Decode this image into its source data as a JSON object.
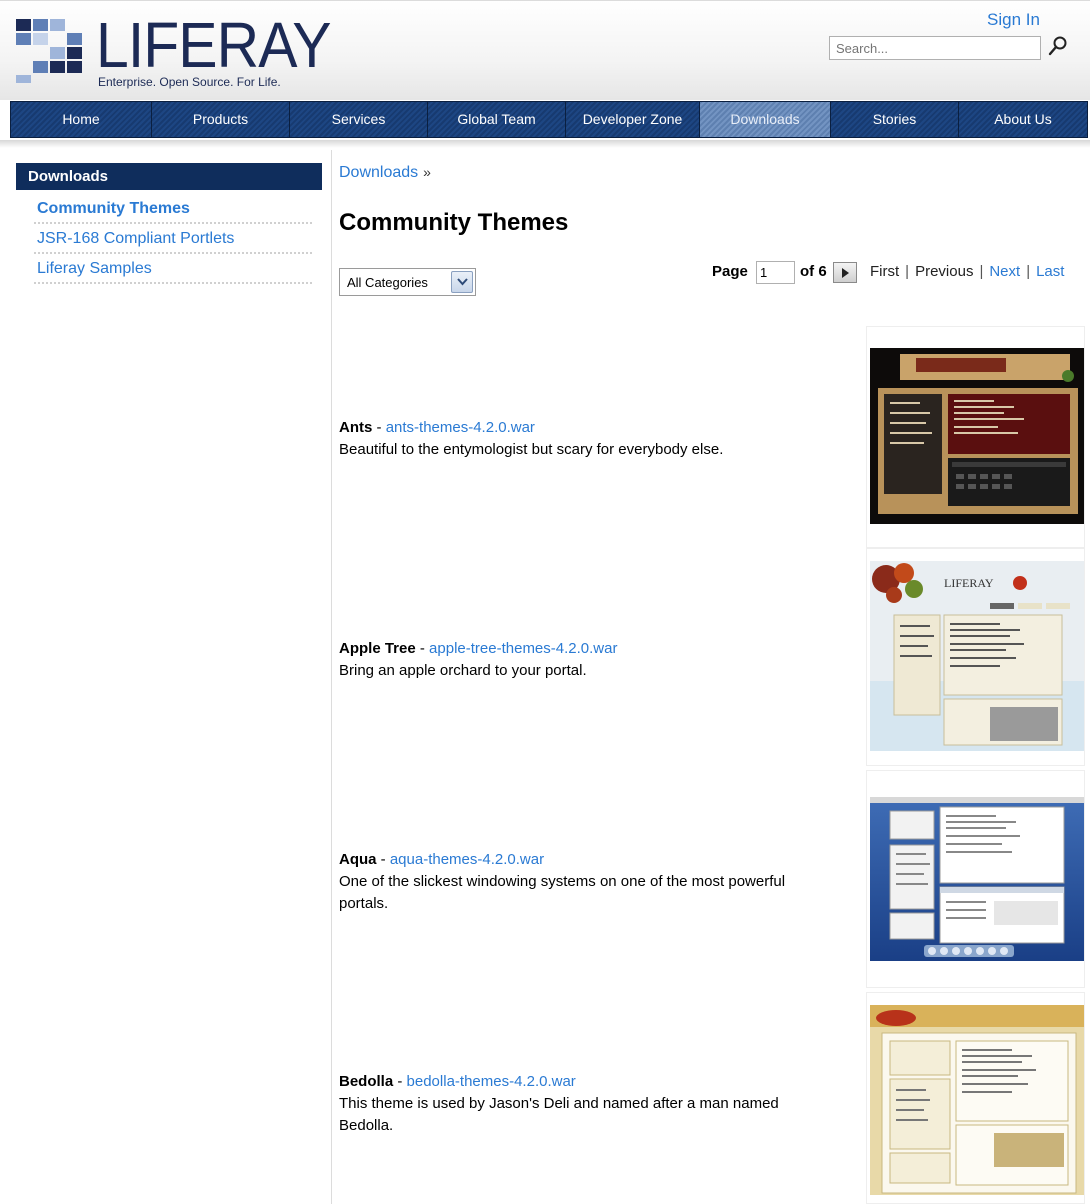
{
  "header": {
    "logo_text": "LIFERAY",
    "logo_tagline": "Enterprise. Open Source. For Life.",
    "sign_in": "Sign In",
    "search_placeholder": "Search..."
  },
  "nav": {
    "items": [
      {
        "label": "Home"
      },
      {
        "label": "Products"
      },
      {
        "label": "Services"
      },
      {
        "label": "Global Team"
      },
      {
        "label": "Developer Zone"
      },
      {
        "label": "Downloads"
      },
      {
        "label": "Stories"
      },
      {
        "label": "About Us"
      }
    ],
    "active": "Downloads"
  },
  "sidebar": {
    "title": "Downloads",
    "items": [
      {
        "label": "Community Themes"
      },
      {
        "label": "JSR-168 Compliant Portlets"
      },
      {
        "label": "Liferay Samples"
      }
    ]
  },
  "main": {
    "breadcrumb": "Downloads",
    "breadcrumb_sep": "»",
    "title": "Community Themes",
    "category_select": "All Categories",
    "pager": {
      "page_label": "Page",
      "page_value": "1",
      "of_label": "of 6",
      "first": "First",
      "previous": "Previous",
      "next": "Next",
      "last": "Last"
    },
    "themes": [
      {
        "name": "Ants",
        "file": "ants-themes-4.2.0.war",
        "description": "Beautiful to the entymologist but scary for everybody else."
      },
      {
        "name": "Apple Tree",
        "file": "apple-tree-themes-4.2.0.war",
        "description": "Bring an apple orchard to your portal."
      },
      {
        "name": "Aqua",
        "file": "aqua-themes-4.2.0.war",
        "description": "One of the slickest windowing systems on one of the most powerful portals."
      },
      {
        "name": "Bedolla",
        "file": "bedolla-themes-4.2.0.war",
        "description": "This theme is used by Jason's Deli and named after a man named Bedolla."
      }
    ],
    "thumb_logo_apple": "LIFERAY"
  },
  "colors": {
    "nav_bg": "#0f2d5c",
    "link": "#2a7ad3",
    "brand_text": "#1c2a55"
  }
}
